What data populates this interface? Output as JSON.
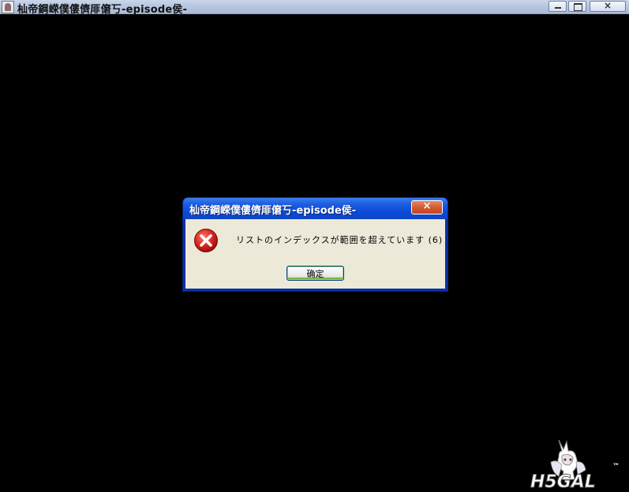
{
  "window": {
    "title": "杣帝鋼嵘僕僂儕厞僒丂-episode侯-",
    "controls": {
      "minimize": "minimize",
      "maximize": "maximize",
      "close": "×"
    }
  },
  "dialog": {
    "title": "杣帝鋼嵘僕僂儕厞僒丂-episode侯-",
    "close_label": "×",
    "icon": "error-icon",
    "message": "リストのインデックスが範囲を超えています (6)",
    "ok_label": "确定"
  },
  "watermark": {
    "text": "H5GAL",
    "tm": "™"
  },
  "colors": {
    "dialog_titlebar": "#0a49d6",
    "dialog_body": "#ece9d8",
    "error_red": "#c8201c",
    "background": "#000000"
  }
}
